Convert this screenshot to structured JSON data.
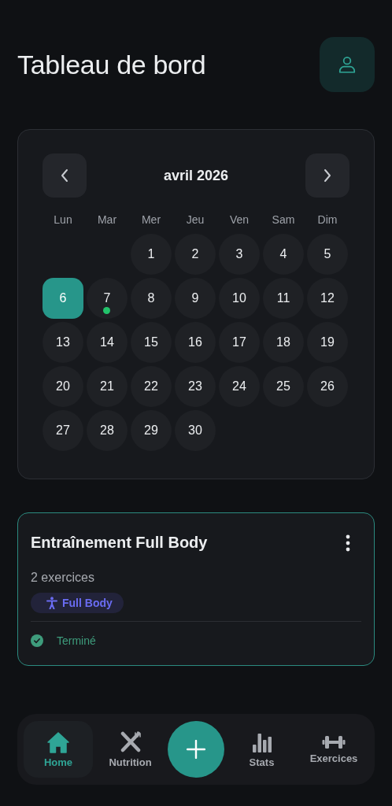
{
  "header": {
    "title": "Tableau de bord"
  },
  "calendar": {
    "month": "avril 2026",
    "weekdays": [
      "Lun",
      "Mar",
      "Mer",
      "Jeu",
      "Ven",
      "Sam",
      "Dim"
    ],
    "days": [
      {
        "kind": "empty"
      },
      {
        "kind": "empty"
      },
      {
        "kind": "day",
        "label": "1",
        "selected": false,
        "has_event": false
      },
      {
        "kind": "day",
        "label": "2",
        "selected": false,
        "has_event": false
      },
      {
        "kind": "day",
        "label": "3",
        "selected": false,
        "has_event": false
      },
      {
        "kind": "day",
        "label": "4",
        "selected": false,
        "has_event": false
      },
      {
        "kind": "day",
        "label": "5",
        "selected": false,
        "has_event": false
      },
      {
        "kind": "day",
        "label": "6",
        "selected": true,
        "has_event": false
      },
      {
        "kind": "day",
        "label": "7",
        "selected": false,
        "has_event": true
      },
      {
        "kind": "day",
        "label": "8",
        "selected": false,
        "has_event": false
      },
      {
        "kind": "day",
        "label": "9",
        "selected": false,
        "has_event": false
      },
      {
        "kind": "day",
        "label": "10",
        "selected": false,
        "has_event": false
      },
      {
        "kind": "day",
        "label": "11",
        "selected": false,
        "has_event": false
      },
      {
        "kind": "day",
        "label": "12",
        "selected": false,
        "has_event": false
      },
      {
        "kind": "day",
        "label": "13",
        "selected": false,
        "has_event": false
      },
      {
        "kind": "day",
        "label": "14",
        "selected": false,
        "has_event": false
      },
      {
        "kind": "day",
        "label": "15",
        "selected": false,
        "has_event": false
      },
      {
        "kind": "day",
        "label": "16",
        "selected": false,
        "has_event": false
      },
      {
        "kind": "day",
        "label": "17",
        "selected": false,
        "has_event": false
      },
      {
        "kind": "day",
        "label": "18",
        "selected": false,
        "has_event": false
      },
      {
        "kind": "day",
        "label": "19",
        "selected": false,
        "has_event": false
      },
      {
        "kind": "day",
        "label": "20",
        "selected": false,
        "has_event": false
      },
      {
        "kind": "day",
        "label": "21",
        "selected": false,
        "has_event": false
      },
      {
        "kind": "day",
        "label": "22",
        "selected": false,
        "has_event": false
      },
      {
        "kind": "day",
        "label": "23",
        "selected": false,
        "has_event": false
      },
      {
        "kind": "day",
        "label": "24",
        "selected": false,
        "has_event": false
      },
      {
        "kind": "day",
        "label": "25",
        "selected": false,
        "has_event": false
      },
      {
        "kind": "day",
        "label": "26",
        "selected": false,
        "has_event": false
      },
      {
        "kind": "day",
        "label": "27",
        "selected": false,
        "has_event": false
      },
      {
        "kind": "day",
        "label": "28",
        "selected": false,
        "has_event": false
      },
      {
        "kind": "day",
        "label": "29",
        "selected": false,
        "has_event": false
      },
      {
        "kind": "day",
        "label": "30",
        "selected": false,
        "has_event": false
      }
    ]
  },
  "workout": {
    "title": "Entraînement Full Body",
    "subtitle": "2 exercices",
    "tag": "Full Body",
    "status": "Terminé",
    "completed": true
  },
  "nav": [
    {
      "kind": "tab",
      "label": "Home",
      "selected": true
    },
    {
      "kind": "tab",
      "label": "Nutrition",
      "selected": false
    },
    {
      "kind": "add"
    },
    {
      "kind": "tab",
      "label": "Stats",
      "selected": false
    },
    {
      "kind": "tab",
      "label": "Exercices",
      "selected": false
    }
  ]
}
